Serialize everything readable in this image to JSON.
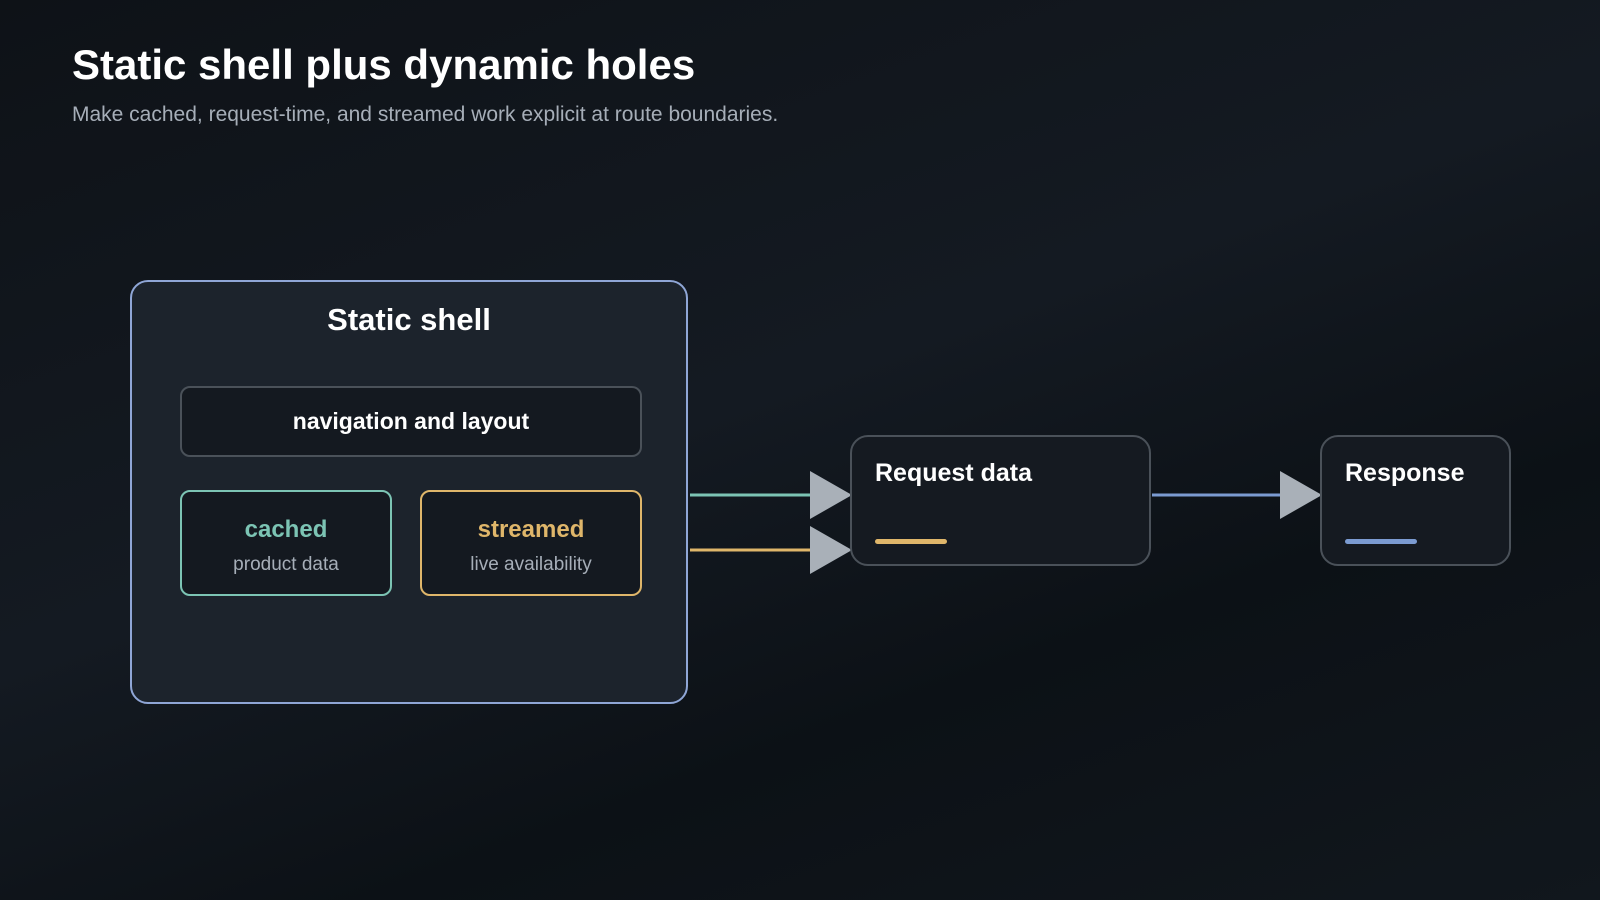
{
  "header": {
    "title": "Static shell plus dynamic holes",
    "subtitle": "Make cached, request-time, and streamed work explicit at route boundaries."
  },
  "shell": {
    "title": "Static shell",
    "navigation": "navigation and layout",
    "holes": [
      {
        "label": "cached",
        "sublabel": "product data",
        "color": "#7cc4b4"
      },
      {
        "label": "streamed",
        "sublabel": "live availability",
        "color": "#dfb66a"
      }
    ],
    "border_color": "#8fa6d6"
  },
  "nodes": {
    "request": {
      "title": "Request data",
      "accent_color": "#dfb66a"
    },
    "response": {
      "title": "Response",
      "accent_color": "#7b9bd1"
    }
  },
  "edges": [
    {
      "from": "shell",
      "to": "request",
      "color": "#7cc4b4"
    },
    {
      "from": "shell",
      "to": "request",
      "color": "#dfb66a"
    },
    {
      "from": "request",
      "to": "response",
      "color": "#7b9bd1"
    }
  ],
  "colors": {
    "arrowhead": "#a9b0b8",
    "node_border": "#4a5159",
    "subtitle_text": "#a6aeb8"
  }
}
